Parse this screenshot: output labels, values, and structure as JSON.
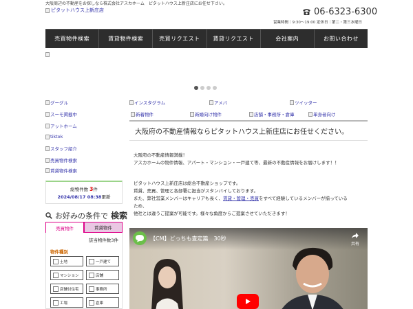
{
  "header": {
    "tagline": "大阪周辺の不動産をお探しなら株式会社アスカホーム　ピタットハウス上新庄店にお任せ下さい。",
    "logo_alt": "ピタットハウス上新庄店",
    "phone": "06-6323-6300",
    "hours": "営業時間｜9:30～19:00 定休日｜第二・第三水曜日"
  },
  "nav": {
    "items": [
      "売買物件検索",
      "賃貸物件検索",
      "売買リクエスト",
      "賃貸リクエスト",
      "会社案内",
      "お問い合わせ"
    ]
  },
  "slider": {
    "dot_count": 4,
    "active_index": 0
  },
  "sidebar": {
    "links": [
      "グーグル",
      "スーモ掲載中",
      "アットホーム",
      "tiktok",
      "スタッフ紹介",
      "売買物件検索",
      "賃貸物件検索"
    ],
    "count_label": "総物件数",
    "count_value": "3",
    "count_unit": "件",
    "updated_date": "2024/08/17 08:38",
    "updated_suffix": "更新"
  },
  "search": {
    "title_pre": "お好みの条件で",
    "title_strong": "検索",
    "tab_sale": "売買物件",
    "tab_rent": "賃貸物件",
    "result": "該当物件数3件",
    "property_type_label": "物件種別",
    "options": [
      "土地",
      "一戸建て",
      "マンション",
      "店舗",
      "店舗付住宅",
      "事務所",
      "工場",
      "倉庫"
    ]
  },
  "top_links": {
    "row1": [
      "インスタグラム",
      "アメバ",
      "ツイッター"
    ],
    "row2": [
      "新着物件",
      "新婚向け物件",
      "店舗・事務所・倉庫",
      "単身者向け"
    ]
  },
  "main": {
    "heading": "大阪府の不動産情報ならピタットハウス上新庄店にお任せください。",
    "p1_line1": "大阪府の不動産情報満載！",
    "p1_line2": "アスカホームの物件情報、アパート・マンション・一戸建て等、最新の不動産情報をお届けします！！",
    "p2_line1": "ピタットハウス上新庄店は総合不動産ショップです。",
    "p2_line2": "賃貸、売買、管理と各部署に担当がスタンバイしております。",
    "p2_line3_pre": "また、弊社営業メンバーはキャリアも長く、",
    "p2_line3_link": "賃貸・管理・売買",
    "p2_line3_post": "をすべて経験しているメンバーが揃っている",
    "p2_line4": "ため、",
    "p2_line5": "他社とは違うご提案が可能です。様々な角度からご提案させていただきます！"
  },
  "video": {
    "title": "【CM】どっちも査定篇　30秒",
    "share_label": "共有"
  }
}
